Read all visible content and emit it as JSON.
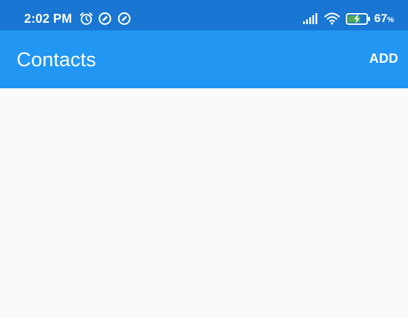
{
  "status_bar": {
    "time": "2:02 PM",
    "battery_percent": "67",
    "battery_percent_sign": "%",
    "icons": [
      "alarm-icon",
      "app-notification-icon",
      "app-notification-icon",
      "signal-icon",
      "wifi-icon",
      "battery-charging-icon"
    ],
    "background_color": "#1976d2"
  },
  "app_bar": {
    "title": "Contacts",
    "add_label": "ADD",
    "background_color": "#2196f3"
  },
  "content": {
    "background_color": "#fafafa"
  }
}
